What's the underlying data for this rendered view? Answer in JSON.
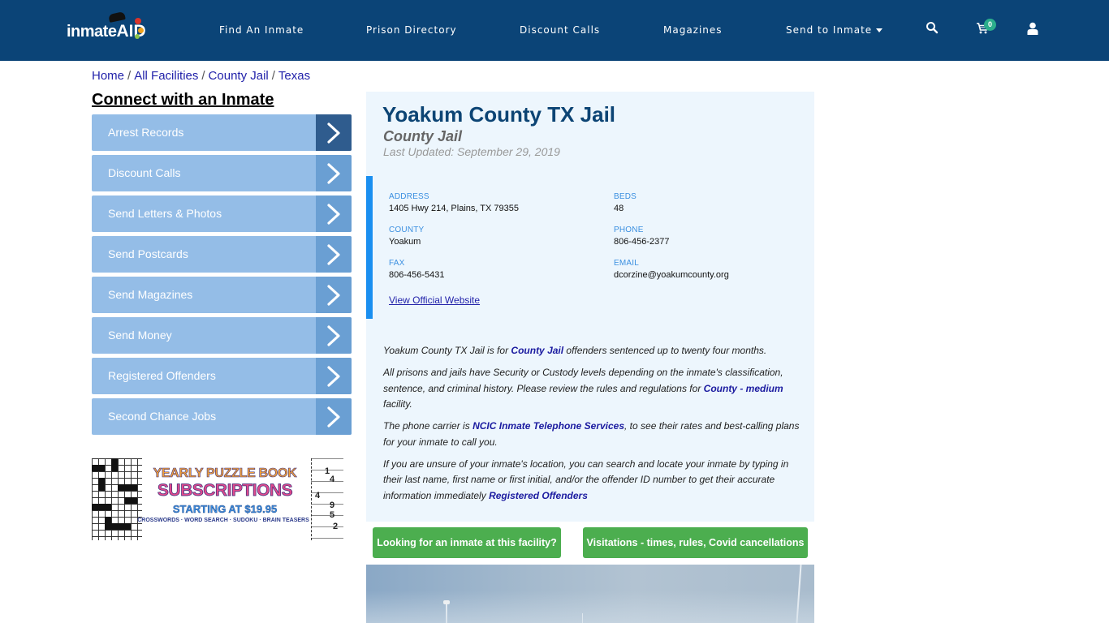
{
  "header": {
    "logo": {
      "text": "inmate",
      "accent": "AID"
    },
    "nav": [
      {
        "label": "Find An Inmate"
      },
      {
        "label": "Prison Directory"
      },
      {
        "label": "Discount Calls"
      },
      {
        "label": "Magazines"
      },
      {
        "label": "Send to Inmate",
        "has_dropdown": true
      }
    ],
    "icons": {
      "search": "search-icon",
      "cart": "cart-icon",
      "user": "user-icon"
    },
    "cart_count": "0"
  },
  "breadcrumb": [
    {
      "label": "Home"
    },
    {
      "label": "All Facilities"
    },
    {
      "label": "County Jail"
    },
    {
      "label": "Texas"
    }
  ],
  "breadcrumb_separator": "/",
  "sidebar": {
    "title": "Connect with an Inmate",
    "items": [
      {
        "label": "Arrest Records",
        "active": true
      },
      {
        "label": "Discount Calls"
      },
      {
        "label": "Send Letters & Photos"
      },
      {
        "label": "Send Postcards"
      },
      {
        "label": "Send Magazines"
      },
      {
        "label": "Send Money"
      },
      {
        "label": "Registered Offenders"
      },
      {
        "label": "Second Chance Jobs"
      }
    ],
    "ad": {
      "line1": "YEARLY PUZZLE BOOK",
      "line2": "SUBSCRIPTIONS",
      "line3": "STARTING AT $19.95",
      "line4": "CROSSWORDS · WORD SEARCH · SUDOKU · BRAIN TEASERS",
      "sudoku_numbers": [
        "1",
        "4",
        "4",
        "9",
        "5",
        "2"
      ]
    }
  },
  "facility": {
    "name": "Yoakum County TX Jail",
    "type": "County Jail",
    "last_updated": "Last Updated: September 29, 2019",
    "fields": {
      "address": {
        "label": "ADDRESS",
        "value": "1405 Hwy 214, Plains, TX 79355"
      },
      "beds": {
        "label": "BEDS",
        "value": "48"
      },
      "county": {
        "label": "COUNTY",
        "value": "Yoakum"
      },
      "phone": {
        "label": "PHONE",
        "value": "806-456-2377"
      },
      "fax": {
        "label": "FAX",
        "value": "806-456-5431"
      },
      "email": {
        "label": "EMAIL",
        "value": "dcorzine@yoakumcounty.org"
      }
    },
    "website_link": "View Official Website",
    "description": {
      "p1": {
        "pre": "Yoakum County TX Jail is for ",
        "link": "County Jail",
        "post": " offenders sentenced up to twenty four months."
      },
      "p2": {
        "pre": "All prisons and jails have Security or Custody levels depending on the inmate's classification, sentence, and criminal history. Please review the rules and regulations for ",
        "link": "County - medium",
        "post": " facility."
      },
      "p3": {
        "pre": "The phone carrier is ",
        "link": "NCIC Inmate Telephone Services",
        "post": ", to see their rates and best-calling plans for your inmate to call you."
      },
      "p4": {
        "pre": "If you are unsure of your inmate's location, you can search and locate your inmate by typing in their last name, first name or first initial, and/or the offender ID number to get their accurate information immediately ",
        "link": "Registered Offenders",
        "post": ""
      }
    }
  },
  "buttons": {
    "find_inmate": "Looking for an inmate at this facility?",
    "visitations": "Visitations - times, rules, Covid cancellations"
  },
  "colors": {
    "header_bg": "#0b4477",
    "sidebar_item": "#94bde7",
    "sidebar_arrow": "#6a9fd3",
    "sidebar_arrow_active": "#2f5c8e",
    "card_bg": "#edf6fd",
    "accent_bar": "#1a8ff0",
    "title": "#0c4474",
    "green_button": "#4cae4f",
    "link": "#1b1ba0"
  }
}
